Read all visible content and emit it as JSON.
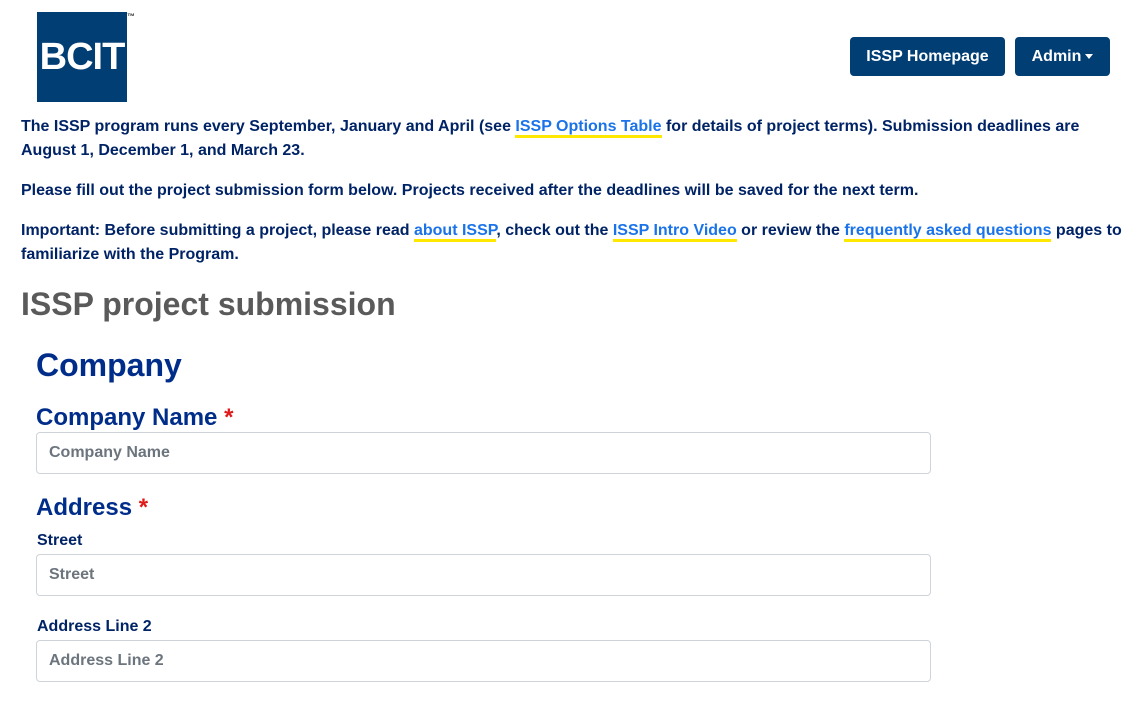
{
  "header": {
    "logo_text": "BCIT",
    "logo_tm": "™",
    "nav": {
      "home_label": "ISSP Homepage",
      "admin_label": "Admin"
    }
  },
  "intro": {
    "p1_before": "The ISSP program runs every September, January and April (see ",
    "p1_link": "ISSP Options Table",
    "p1_after": " for details of project terms). Submission deadlines are August 1, December 1, and March 23.",
    "p2": "Please fill out the project submission form below. Projects received after the deadlines will be saved for the next term.",
    "p3_before": "Important: Before submitting a project, please read ",
    "p3_link1": "about ISSP",
    "p3_mid1": ", check out the ",
    "p3_link2": "ISSP Intro Video",
    "p3_mid2": " or review the ",
    "p3_link3": "frequently asked questions",
    "p3_after": " pages to familiarize with the Program."
  },
  "form": {
    "title": "ISSP project submission",
    "section": "Company",
    "company_name": {
      "label": "Company Name",
      "required": "*",
      "placeholder": "Company Name"
    },
    "address": {
      "label": "Address",
      "required": "*",
      "street": {
        "label": "Street",
        "placeholder": "Street"
      },
      "line2": {
        "label": "Address Line 2",
        "placeholder": "Address Line 2"
      }
    }
  },
  "colors": {
    "brand": "#003e74",
    "link": "#1a73e8",
    "link_underline": "#ffe800",
    "required": "#e01a1a",
    "heading": "#002d8a"
  },
  "icons": {
    "admin_dropdown": "caret-down-icon"
  }
}
